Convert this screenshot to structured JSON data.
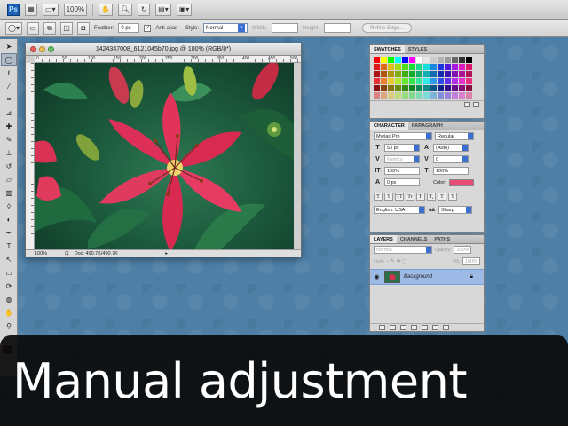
{
  "app_bar": {
    "logo": "Ps",
    "zoom_level": "100%"
  },
  "options_bar": {
    "feather_label": "Feather:",
    "feather_value": "0 px",
    "antialias_label": "Anti-alias",
    "antialias_checked": true,
    "style_label": "Style:",
    "style_value": "Normal",
    "width_label": "Width:",
    "height_label": "Height:",
    "refine_edge_label": "Refine Edge..."
  },
  "document": {
    "title": "1424347008_6121045b70.jpg @ 100% (RGB/8*)",
    "ruler_ticks": [
      "0",
      "50",
      "100",
      "150",
      "200",
      "250",
      "300",
      "350",
      "400",
      "450",
      "500"
    ],
    "status_zoom": "100%",
    "status_doc": "Doc: 490.7K/490.7K"
  },
  "swatches_panel": {
    "tabs": [
      "SWATCHES",
      "STYLES"
    ],
    "active_tab": "SWATCHES"
  },
  "character_panel": {
    "tabs": [
      "CHARACTER",
      "PARAGRAPH"
    ],
    "active_tab": "CHARACTER",
    "font_family": "Myriad Pro",
    "font_style": "Regular",
    "font_size": "50 px",
    "leading": "(Auto)",
    "kerning": "Metrics",
    "tracking": "0",
    "vertical_scale": "100%",
    "horizontal_scale": "100%",
    "baseline_shift": "0 px",
    "color_label": "Color:",
    "text_color": "#e84a73",
    "language": "English: USA",
    "antialias_abbr": "aa",
    "antialias_method": "Sharp",
    "style_buttons": [
      "T",
      "T",
      "TT",
      "Tr",
      "T'",
      "T,",
      "T",
      "T"
    ]
  },
  "layers_panel": {
    "tabs": [
      "LAYERS",
      "CHANNELS",
      "PATHS"
    ],
    "active_tab": "LAYERS",
    "blend_mode": "Normal",
    "opacity_label": "Opacity:",
    "opacity_value": "100%",
    "lock_label": "Lock:",
    "fill_label": "Fill:",
    "fill_value": "100%",
    "layer_name": "Background"
  },
  "caption": {
    "text": "Manual adjustment"
  },
  "colors": {
    "desktop": "#4e7fa6",
    "accent_blue": "#3b6fd1",
    "foreground_swatch": "#5a1726"
  }
}
